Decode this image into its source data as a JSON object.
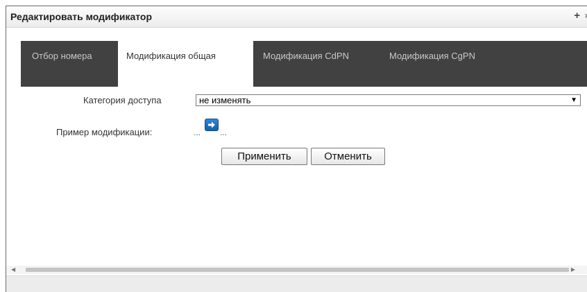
{
  "dialog": {
    "title": "Редактировать модификатор",
    "plus_label": "+",
    "close_label": "×"
  },
  "tabs": [
    {
      "label": "Отбор номера",
      "active": false
    },
    {
      "label": "Модификация общая",
      "active": true
    },
    {
      "label": "Модификация CdPN",
      "active": false
    },
    {
      "label": "Модификация CgPN",
      "active": false
    }
  ],
  "form": {
    "access_category_label": "Категория доступа",
    "access_category_value": "не изменять",
    "example_label": "Пример модификации:",
    "example_before": "...",
    "example_after": "..."
  },
  "buttons": {
    "apply": "Применить",
    "cancel": "Отменить"
  },
  "icons": {
    "example_arrow": "arrow-right-icon",
    "select_dropdown": "triangle-down-icon"
  },
  "colors": {
    "tab_bar": "#414141",
    "arrow_button": "#1f73c4"
  }
}
